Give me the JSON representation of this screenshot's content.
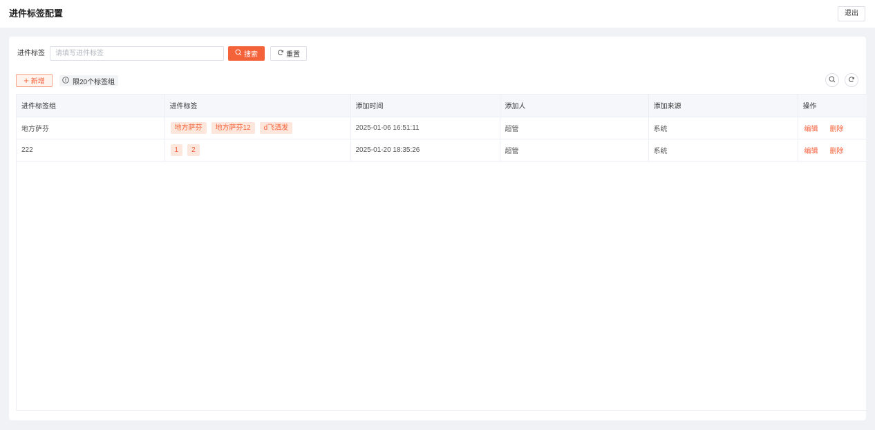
{
  "header": {
    "title": "进件标签配置",
    "logout_label": "退出"
  },
  "search": {
    "label": "进件标签",
    "value": "",
    "placeholder": "请填写进件标签",
    "search_label": "搜索",
    "reset_label": "重置"
  },
  "toolbar": {
    "add_label": "新增",
    "limit_text": "限20个标签组",
    "right_icons": [
      "search-icon",
      "refresh-icon"
    ]
  },
  "table": {
    "columns": [
      "进件标签组",
      "进件标签",
      "添加时间",
      "添加人",
      "添加来源",
      "操作"
    ],
    "rows": [
      {
        "group": "地方萨芬",
        "tags": [
          "地方萨芬",
          "地方萨芬12",
          "d飞洒发"
        ],
        "time": "2025-01-06 16:51:11",
        "creator": "超管",
        "source": "系统",
        "actions": [
          "编辑",
          "删除"
        ]
      },
      {
        "group": "222",
        "tags": [
          "1",
          "2"
        ],
        "time": "2025-01-20 18:35:26",
        "creator": "超管",
        "source": "系统",
        "actions": [
          "编辑",
          "删除"
        ]
      }
    ]
  },
  "colors": {
    "primary": "#f4623a",
    "tag_background": "#fde6db",
    "page_background": "#f0f2f5"
  }
}
